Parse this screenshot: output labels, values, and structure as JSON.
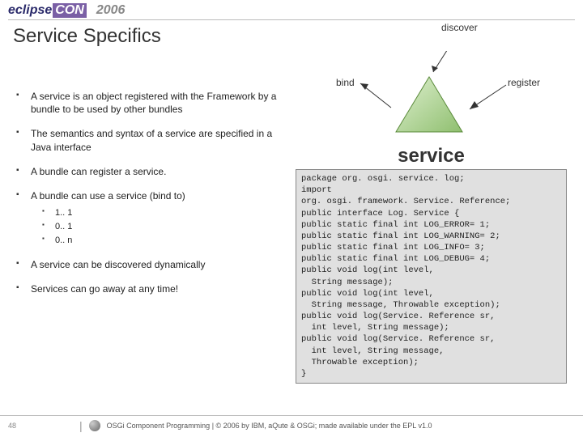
{
  "header": {
    "logo_a": "eclipse",
    "logo_b": "CON",
    "year": "2006"
  },
  "title": "Service Specifics",
  "diagram": {
    "top": "discover",
    "left": "bind",
    "right": "register",
    "center": "service"
  },
  "bullets": {
    "b1": "A service is an object registered with the Framework by a bundle to be used by other bundles",
    "b2": "The semantics and syntax of a service are specified in a Java interface",
    "b3": "A bundle can register a service.",
    "b4": "A bundle can use a service (bind to)",
    "b4a": "1.. 1",
    "b4b": "0.. 1",
    "b4c": "0.. n",
    "b5": "A service can be discovered dynamically",
    "b6": "Services can go away at any time!"
  },
  "code": "package org. osgi. service. log;\nimport\norg. osgi. framework. Service. Reference;\npublic interface Log. Service {\npublic static final int LOG_ERROR= 1;\npublic static final int LOG_WARNING= 2;\npublic static final int LOG_INFO= 3;\npublic static final int LOG_DEBUG= 4;\npublic void log(int level,\n  String message);\npublic void log(int level,\n  String message, Throwable exception);\npublic void log(Service. Reference sr,\n  int level, String message);\npublic void log(Service. Reference sr,\n  int level, String message,\n  Throwable exception);\n}",
  "footer": {
    "page": "48",
    "text": "OSGi Component Programming | © 2006 by IBM, aQute & OSGi; made available under the EPL v1.0"
  }
}
